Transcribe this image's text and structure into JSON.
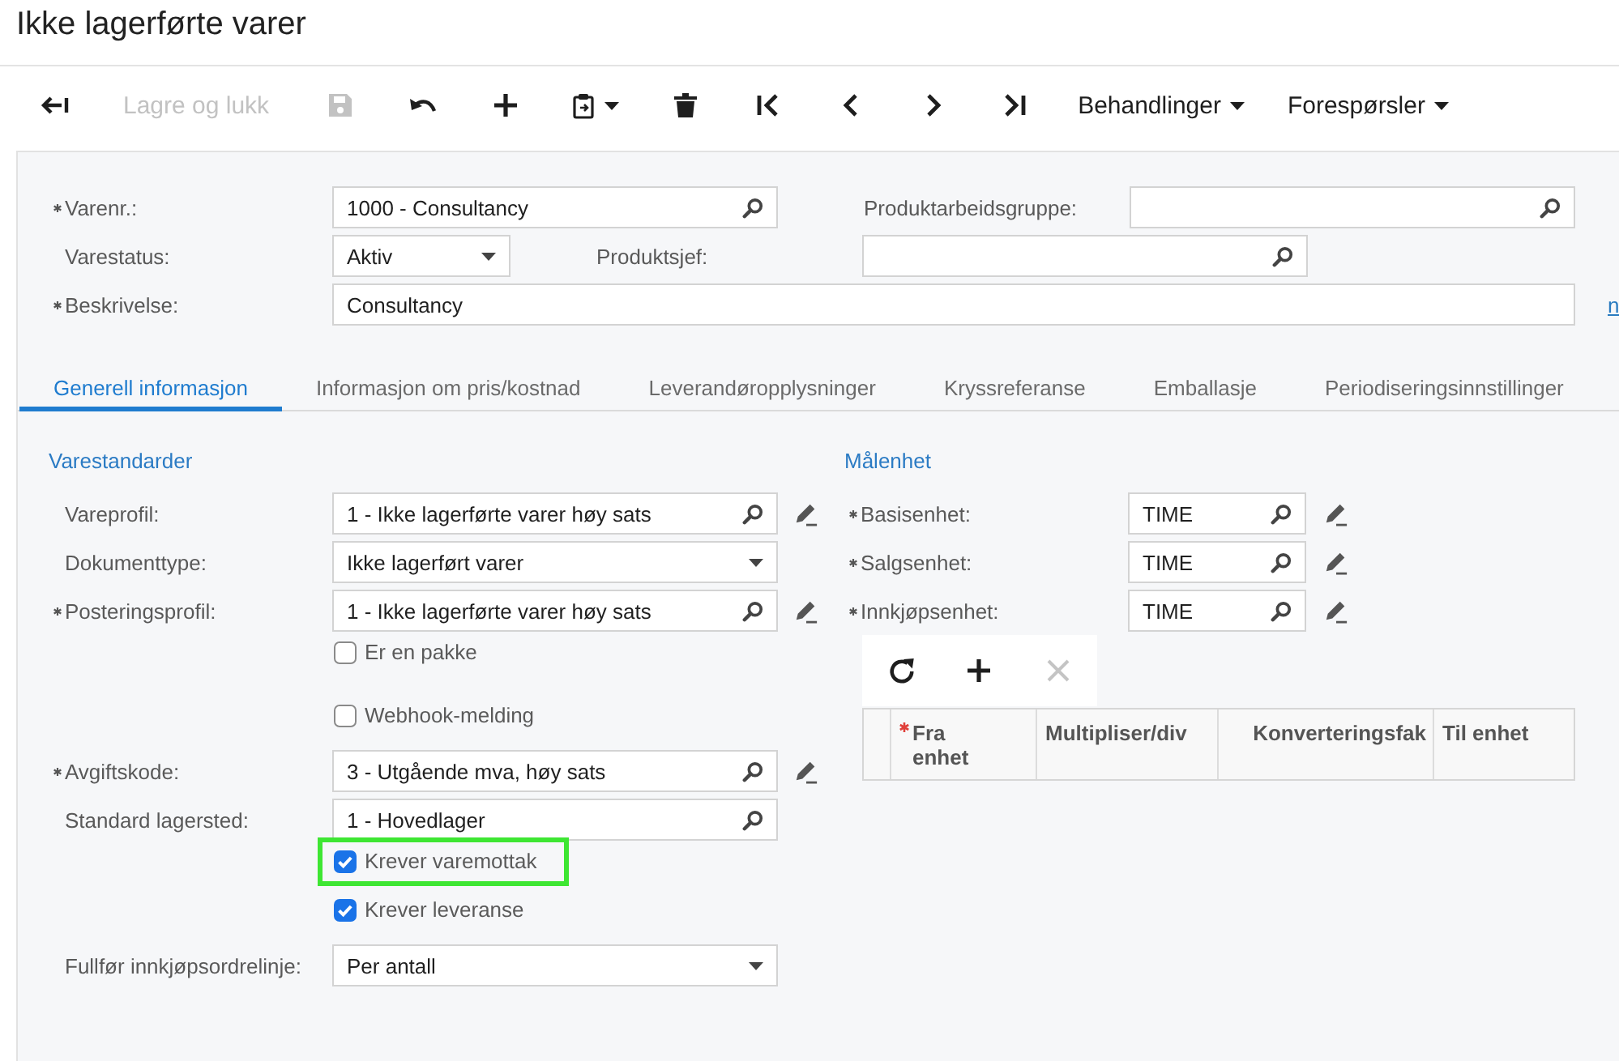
{
  "page": {
    "title": "Ikke lagerførte varer"
  },
  "toolbar": [
    {
      "kind": "back",
      "disabled": false
    },
    {
      "kind": "text",
      "label": "Lagre og lukk",
      "disabled": true
    },
    {
      "kind": "save",
      "disabled": true
    },
    {
      "kind": "undo",
      "disabled": false
    },
    {
      "kind": "add",
      "disabled": false
    },
    {
      "kind": "paste",
      "disabled": false
    },
    {
      "kind": "delete",
      "disabled": false
    },
    {
      "kind": "first",
      "disabled": false
    },
    {
      "kind": "previous",
      "disabled": false
    },
    {
      "kind": "next",
      "disabled": false
    },
    {
      "kind": "last",
      "disabled": false
    },
    {
      "kind": "menu",
      "label": "Behandlinger",
      "disabled": false
    },
    {
      "kind": "menu",
      "label": "Forespørsler",
      "disabled": false
    }
  ],
  "header": {
    "rows": [
      [
        {
          "kind": "lookup",
          "label": "Varenr.:",
          "required": true,
          "value": "1000 - Consultancy"
        },
        {
          "kind": "lookup",
          "label": "Produktarbeidsgruppe:",
          "required": false
        }
      ],
      [
        {
          "kind": "select",
          "label": "Varestatus:",
          "required": false,
          "value": "Aktiv"
        },
        {
          "kind": "lookup",
          "label": "Produktsjef:",
          "required": false
        }
      ]
    ],
    "description": {
      "label": "Beskrivelse:",
      "required": true,
      "value": "Consultancy",
      "link": "n"
    }
  },
  "tabs": [
    {
      "label": "Generell informasjon",
      "selected": true
    },
    {
      "label": "Informasjon om pris/kostnad",
      "selected": false
    },
    {
      "label": "Leverandøropplysninger",
      "selected": false
    },
    {
      "label": "Kryssreferanse",
      "selected": false
    },
    {
      "label": "Emballasje",
      "selected": false
    },
    {
      "label": "Periodiseringsinnstillinger",
      "selected": false
    }
  ],
  "general": {
    "left": {
      "title": "Varestandarder",
      "rows": [
        {
          "kind": "lookup",
          "label": "Vareprofil:",
          "required": false,
          "value": "1 - Ikke lagerførte varer høy sats",
          "edit_button": true
        },
        {
          "kind": "select",
          "label": "Dokumenttype:",
          "required": false,
          "value": "Ikke lagerført varer",
          "edit_button": false
        },
        {
          "kind": "lookup",
          "label": "Posteringsprofil:",
          "required": true,
          "value": "1 - Ikke lagerførte varer høy sats",
          "edit_button": true
        },
        {
          "kind": "checkbox",
          "label": "Er en pakke",
          "checked": false,
          "highlighted": false
        },
        {
          "kind": "checkbox",
          "label": "Webhook-melding",
          "checked": false,
          "highlighted": false
        },
        {
          "kind": "lookup",
          "label": "Avgiftskode:",
          "required": true,
          "value": "3 - Utgående mva, høy sats",
          "edit_button": true
        },
        {
          "kind": "lookup",
          "label": "Standard lagersted:",
          "required": false,
          "value": "1 - Hovedlager",
          "edit_button": false
        },
        {
          "kind": "checkbox",
          "label": "Krever varemottak",
          "checked": true,
          "highlighted": true
        },
        {
          "kind": "checkbox",
          "label": "Krever leveranse",
          "checked": true,
          "highlighted": false
        },
        {
          "kind": "select",
          "label": "Fullfør innkjøpsordrelinje:",
          "required": false,
          "value": "Per antall",
          "edit_button": false
        }
      ]
    },
    "right": {
      "title": "Målenhet",
      "rows": [
        {
          "kind": "lookup",
          "label": "Basisenhet:",
          "required": true,
          "value": "TIME",
          "edit_button": true
        },
        {
          "kind": "lookup",
          "label": "Salgsenhet:",
          "required": true,
          "value": "TIME",
          "edit_button": true
        },
        {
          "kind": "lookup",
          "label": "Innkjøpsenhet:",
          "required": true,
          "value": "TIME",
          "edit_button": true
        }
      ],
      "grid": {
        "actions": [
          {
            "kind": "refresh",
            "disabled": false
          },
          {
            "kind": "add",
            "disabled": false
          },
          {
            "kind": "delete",
            "disabled": true
          }
        ],
        "columns": [
          {
            "label": "Fra enhet",
            "required": true
          },
          {
            "label": "Multipliser/div",
            "required": false
          },
          {
            "label": "Konverteringsfak",
            "required": false
          },
          {
            "label": "Til enhet",
            "required": false
          }
        ]
      }
    }
  }
}
